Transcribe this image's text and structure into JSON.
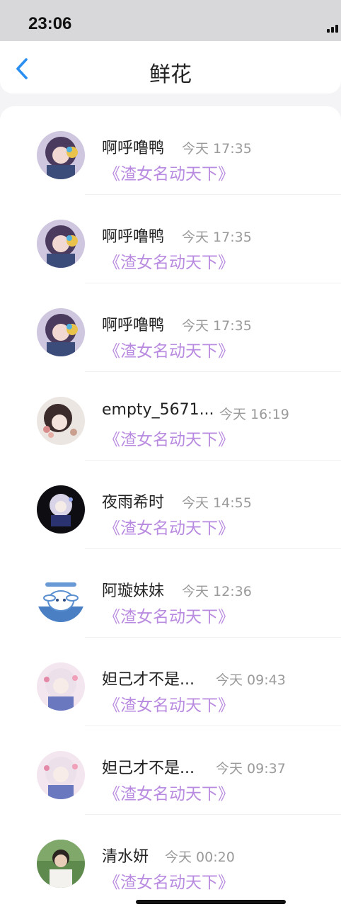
{
  "status_bar": {
    "time": "23:06"
  },
  "header": {
    "title": "鲜花",
    "back_icon": "chevron-left-icon"
  },
  "accent_color": "#2a8ff0",
  "book_title_color": "#b98be0",
  "items": [
    {
      "username": "啊呼噜鸭",
      "time": "今天 17:35",
      "book": "《渣女名动天下》",
      "avatar": "anime-boy"
    },
    {
      "username": "啊呼噜鸭",
      "time": "今天 17:35",
      "book": "《渣女名动天下》",
      "avatar": "anime-boy"
    },
    {
      "username": "啊呼噜鸭",
      "time": "今天 17:35",
      "book": "《渣女名动天下》",
      "avatar": "anime-boy"
    },
    {
      "username": "empty_5671...",
      "time": "今天 16:19",
      "book": "《渣女名动天下》",
      "avatar": "girl-flowers"
    },
    {
      "username": "夜雨希时",
      "time": "今天 14:55",
      "book": "《渣女名动天下》",
      "avatar": "dark-girl"
    },
    {
      "username": "阿璇妹妹",
      "time": "今天 12:36",
      "book": "《渣女名动天下》",
      "avatar": "cinnamoroll"
    },
    {
      "username": "妲己才不是...",
      "time": "今天 09:43",
      "book": "《渣女名动天下》",
      "avatar": "pink-girl"
    },
    {
      "username": "妲己才不是...",
      "time": "今天 09:37",
      "book": "《渣女名动天下》",
      "avatar": "pink-girl"
    },
    {
      "username": "清水妍",
      "time": "今天 00:20",
      "book": "《渣女名动天下》",
      "avatar": "photo-boy"
    }
  ]
}
